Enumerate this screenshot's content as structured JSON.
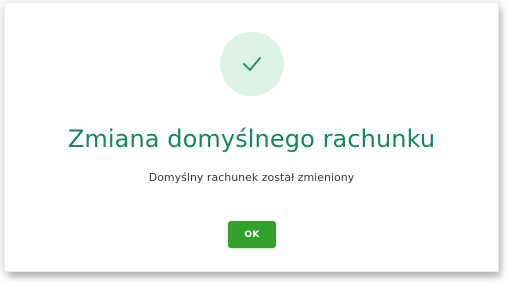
{
  "dialog": {
    "icon": "checkmark-icon",
    "title": "Zmiana domyślnego rachunku",
    "message": "Domyślny rachunek został zmieniony",
    "ok_label": "OK"
  },
  "colors": {
    "accent": "#16895a",
    "success_circle_bg": "#dff2e8",
    "button_bg": "#33a02c"
  }
}
